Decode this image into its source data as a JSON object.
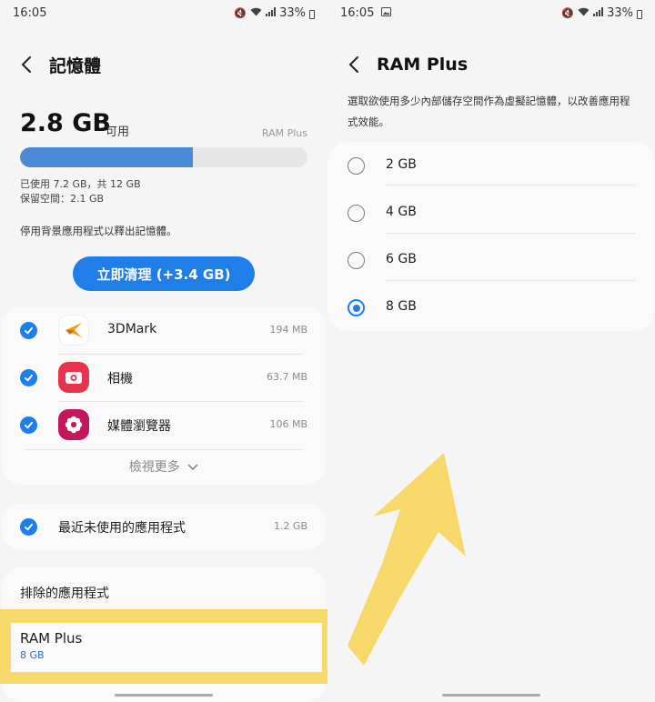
{
  "left": {
    "status": {
      "time": "16:05",
      "battery": "33%"
    },
    "header": {
      "title": "記憶體"
    },
    "memory": {
      "available": "2.8 GB",
      "available_unit": "可用",
      "ram_plus_tag": "RAM Plus",
      "used_fraction": 0.6,
      "used_text": "已使用 7.2 GB，共 12 GB",
      "reserved_text": "保留空間：2.1 GB"
    },
    "hint": "停用背景應用程式以釋出記憶體。",
    "clean_button": "立即清理 (+3.4 GB)",
    "apps": [
      {
        "name": "3DMark",
        "size": "194 MB",
        "icon": "3dmark-icon",
        "checked": true
      },
      {
        "name": "相機",
        "size": "63.7 MB",
        "icon": "camera-icon",
        "checked": true
      },
      {
        "name": "媒體瀏覽器",
        "size": "106 MB",
        "icon": "media-browser-icon",
        "checked": true
      }
    ],
    "view_more": "檢視更多",
    "recent": {
      "label": "最近未使用的應用程式",
      "size": "1.2 GB",
      "checked": true
    },
    "excluded": {
      "title": "排除的應用程式"
    },
    "ram_plus": {
      "name": "RAM Plus",
      "value": "8 GB"
    }
  },
  "right": {
    "status": {
      "time": "16:05",
      "battery": "33%"
    },
    "header": {
      "title": "RAM Plus"
    },
    "description": "選取欲使用多少內部儲存空間作為虛擬記憶體，以改善應用程式效能。",
    "options": [
      {
        "label": "2 GB",
        "selected": false
      },
      {
        "label": "4 GB",
        "selected": false
      },
      {
        "label": "6 GB",
        "selected": false
      },
      {
        "label": "8 GB",
        "selected": true
      }
    ]
  },
  "colors": {
    "accent": "#1f7ee8",
    "bar_fill": "#4a8ad6",
    "highlight": "#f7d96b",
    "link_value": "#2a6fc4"
  }
}
